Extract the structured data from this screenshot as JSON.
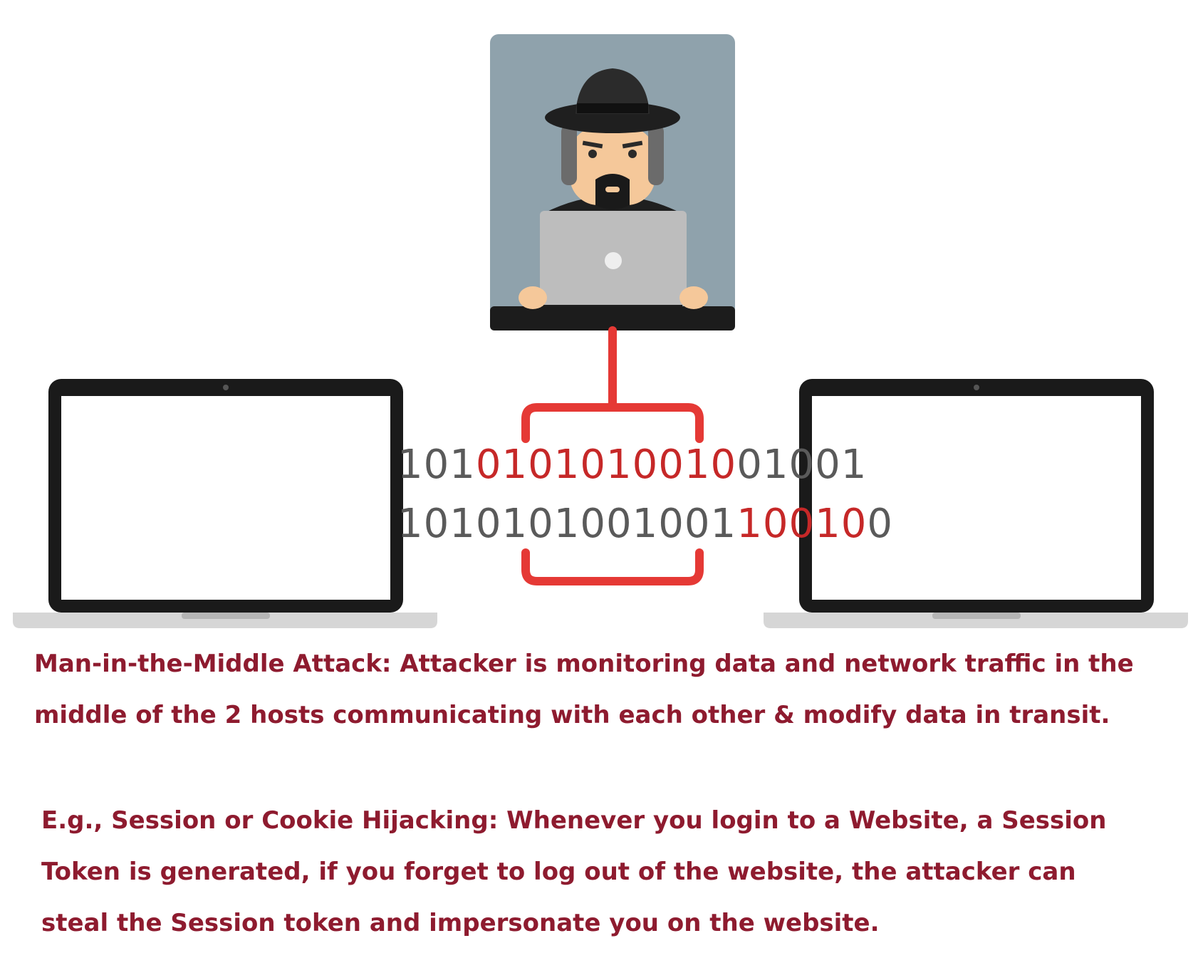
{
  "binary": {
    "line1": {
      "gray_start": "101",
      "red": "0101010010",
      "gray_end": "01001"
    },
    "line2": {
      "gray_start": "1010101001001",
      "red": "10010",
      "gray_end": "0"
    }
  },
  "caption": {
    "main_line1": "Man-in-the-Middle Attack: Attacker is monitoring data and network traffic in the",
    "main_line2": "middle of the 2 hosts communicating with each other & modify data in transit.",
    "example_line1": "E.g., Session or Cookie Hijacking: Whenever you login to a Website, a Session",
    "example_line2": "Token is generated, if you forget to log out of the website, the attacker can",
    "example_line3": "steal the Session token and impersonate you on the website."
  },
  "colors": {
    "caption": "#8e1b2f",
    "accent_red": "#e53935",
    "binary_gray": "#5a5a5a",
    "panel_bg": "#8fa2ac",
    "laptop_frame": "#1a1a1a"
  },
  "icons": [
    "hacker-icon",
    "laptop-icon",
    "connection-bracket-icon"
  ]
}
